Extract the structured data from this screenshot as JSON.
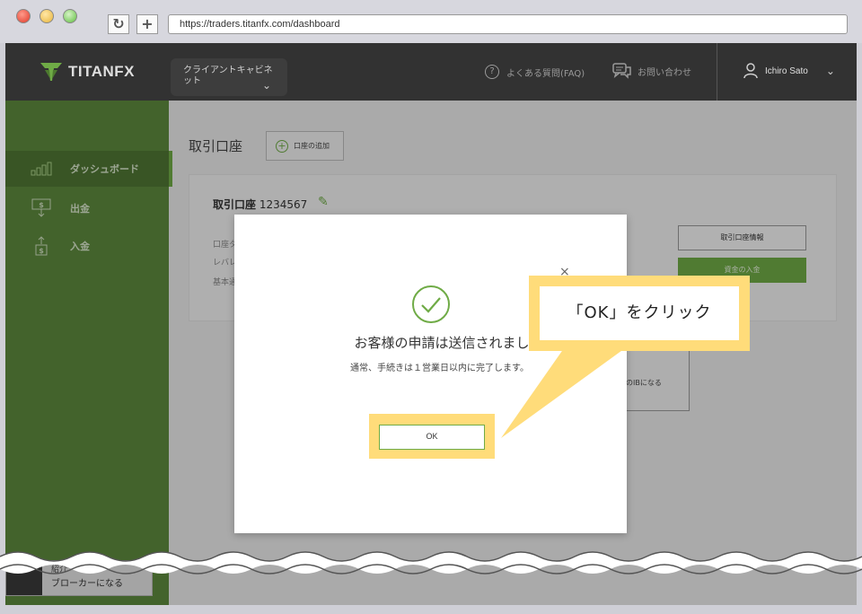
{
  "browser": {
    "url": "https://traders.titanfx.com/dashboard",
    "reload_icon": "reload-icon",
    "newtab_icon": "plus-icon"
  },
  "header": {
    "logo_text": "TITANFX",
    "cabinet_label": "クライアントキャビネット",
    "faq_label": "よくある質問(FAQ)",
    "contact_label": "お問い合わせ",
    "user_name": "Ichiro Sato"
  },
  "sidebar": {
    "items": [
      {
        "label": "ダッシュボード",
        "icon": "bar-chart-icon",
        "active": true
      },
      {
        "label": "出金",
        "icon": "withdraw-icon",
        "active": false
      },
      {
        "label": "入金",
        "icon": "deposit-icon",
        "active": false
      }
    ],
    "ib_line1": "紹介",
    "ib_line2": "ブローカーになる"
  },
  "main": {
    "title": "取引口座",
    "add_account": "口座の追加",
    "account_title_prefix": "取引口座",
    "account_number": "1234567",
    "rows": [
      "口座タ",
      "レバレ",
      "基本通"
    ],
    "btn_info": "取引口座情報",
    "btn_deposit": "資金の入金",
    "ib_partial": "のIBになる"
  },
  "modal": {
    "title": "お客様の申請は送信されました",
    "subtitle": "通常、手続きは１営業日以内に完了します。",
    "ok_label": "OK",
    "close": "×"
  },
  "callout": {
    "text": "「OK」をクリック"
  },
  "colors": {
    "brand_green": "#6fab46",
    "sidebar": "#5e8a3e",
    "highlight": "#ffdc7a",
    "topbar": "#323232"
  }
}
